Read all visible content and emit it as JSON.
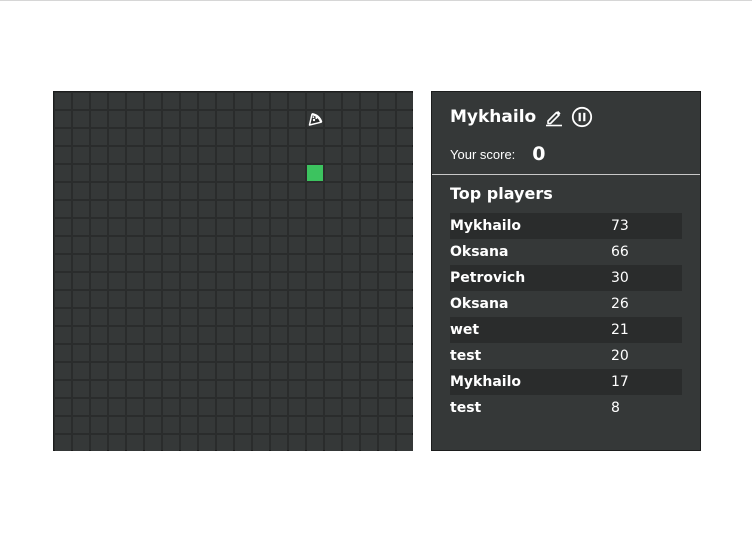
{
  "player": {
    "name": "Mykhailo"
  },
  "score": {
    "label": "Your score:",
    "value": "0"
  },
  "leaderboard": {
    "title": "Top players",
    "rows": [
      {
        "name": "Mykhailo",
        "score": "73"
      },
      {
        "name": "Oksana",
        "score": "66"
      },
      {
        "name": "Petrovich",
        "score": "30"
      },
      {
        "name": "Oksana",
        "score": "26"
      },
      {
        "name": "wet",
        "score": "21"
      },
      {
        "name": "test",
        "score": "20"
      },
      {
        "name": "Mykhailo",
        "score": "17"
      },
      {
        "name": "test",
        "score": "8"
      }
    ]
  },
  "board": {
    "columns": 20,
    "rows": 20,
    "food_icon": "pizza-icon",
    "food_cell": {
      "col": 14,
      "row": 1
    },
    "snake_cells": [
      {
        "col": 14,
        "row": 4
      }
    ]
  },
  "colors": {
    "snake": "#3cc35f",
    "cell": "#353838",
    "board_background": "#2a2c2c",
    "panel_background": "#353838"
  },
  "icons": {
    "edit": "pencil-icon",
    "pause": "pause-icon"
  }
}
